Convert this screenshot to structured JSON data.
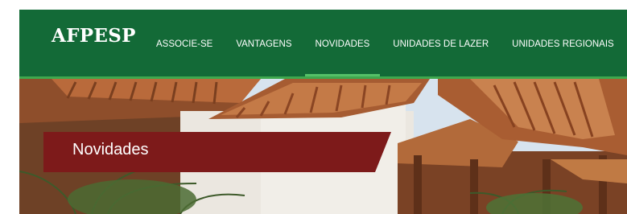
{
  "header": {
    "logo_text": "AFPESP",
    "nav": [
      {
        "label": "ASSOCIE-SE",
        "active": false
      },
      {
        "label": "VANTAGENS",
        "active": false
      },
      {
        "label": "NOVIDADES",
        "active": true
      },
      {
        "label": "UNIDADES DE LAZER",
        "active": false
      },
      {
        "label": "UNIDADES REGIONAIS",
        "active": false
      }
    ]
  },
  "hero": {
    "title": "Novidades"
  },
  "colors": {
    "header_green": "#136a37",
    "active_indicator": "#56c168",
    "title_banner": "#7d1a1a"
  }
}
